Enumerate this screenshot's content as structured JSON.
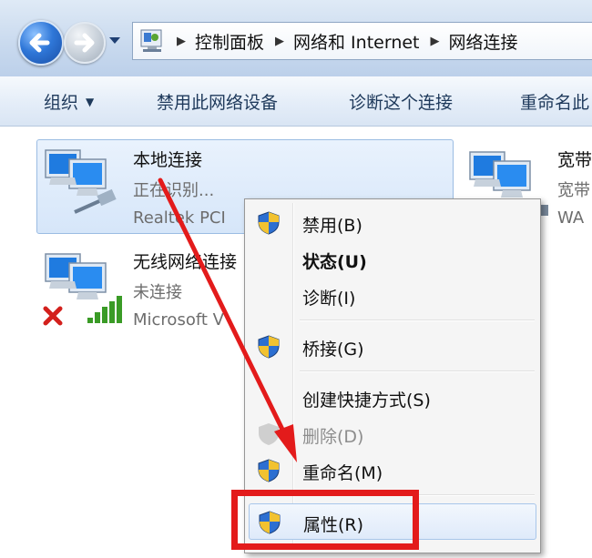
{
  "address_bar": {
    "crumbs": [
      "控制面板",
      "网络和 Internet",
      "网络连接"
    ]
  },
  "command_bar": {
    "organize": "组织",
    "disable": "禁用此网络设备",
    "diagnose": "诊断这个连接",
    "rename": "重命名此"
  },
  "connections": [
    {
      "name": "本地连接",
      "status": "正在识别...",
      "device": "Realtek PCI"
    },
    {
      "name": "无线网络连接",
      "status": "未连接",
      "device": "Microsoft V"
    },
    {
      "name": "宽带",
      "status": "宽带",
      "device": "WA"
    }
  ],
  "context_menu": {
    "items": [
      {
        "label": "禁用(B)",
        "shield": true,
        "bold": false,
        "disabled": false
      },
      {
        "label": "状态(U)",
        "shield": false,
        "bold": true,
        "disabled": false
      },
      {
        "label": "诊断(I)",
        "shield": false,
        "bold": false,
        "disabled": false
      },
      {
        "label": "桥接(G)",
        "shield": true,
        "bold": false,
        "disabled": false
      },
      {
        "label": "创建快捷方式(S)",
        "shield": false,
        "bold": false,
        "disabled": false
      },
      {
        "label": "删除(D)",
        "shield": true,
        "bold": false,
        "disabled": true
      },
      {
        "label": "重命名(M)",
        "shield": true,
        "bold": false,
        "disabled": false
      },
      {
        "label": "属性(R)",
        "shield": true,
        "bold": false,
        "disabled": false
      }
    ]
  },
  "colors": {
    "annotation": "#e31b1b",
    "selection": "#d6e6f9"
  }
}
